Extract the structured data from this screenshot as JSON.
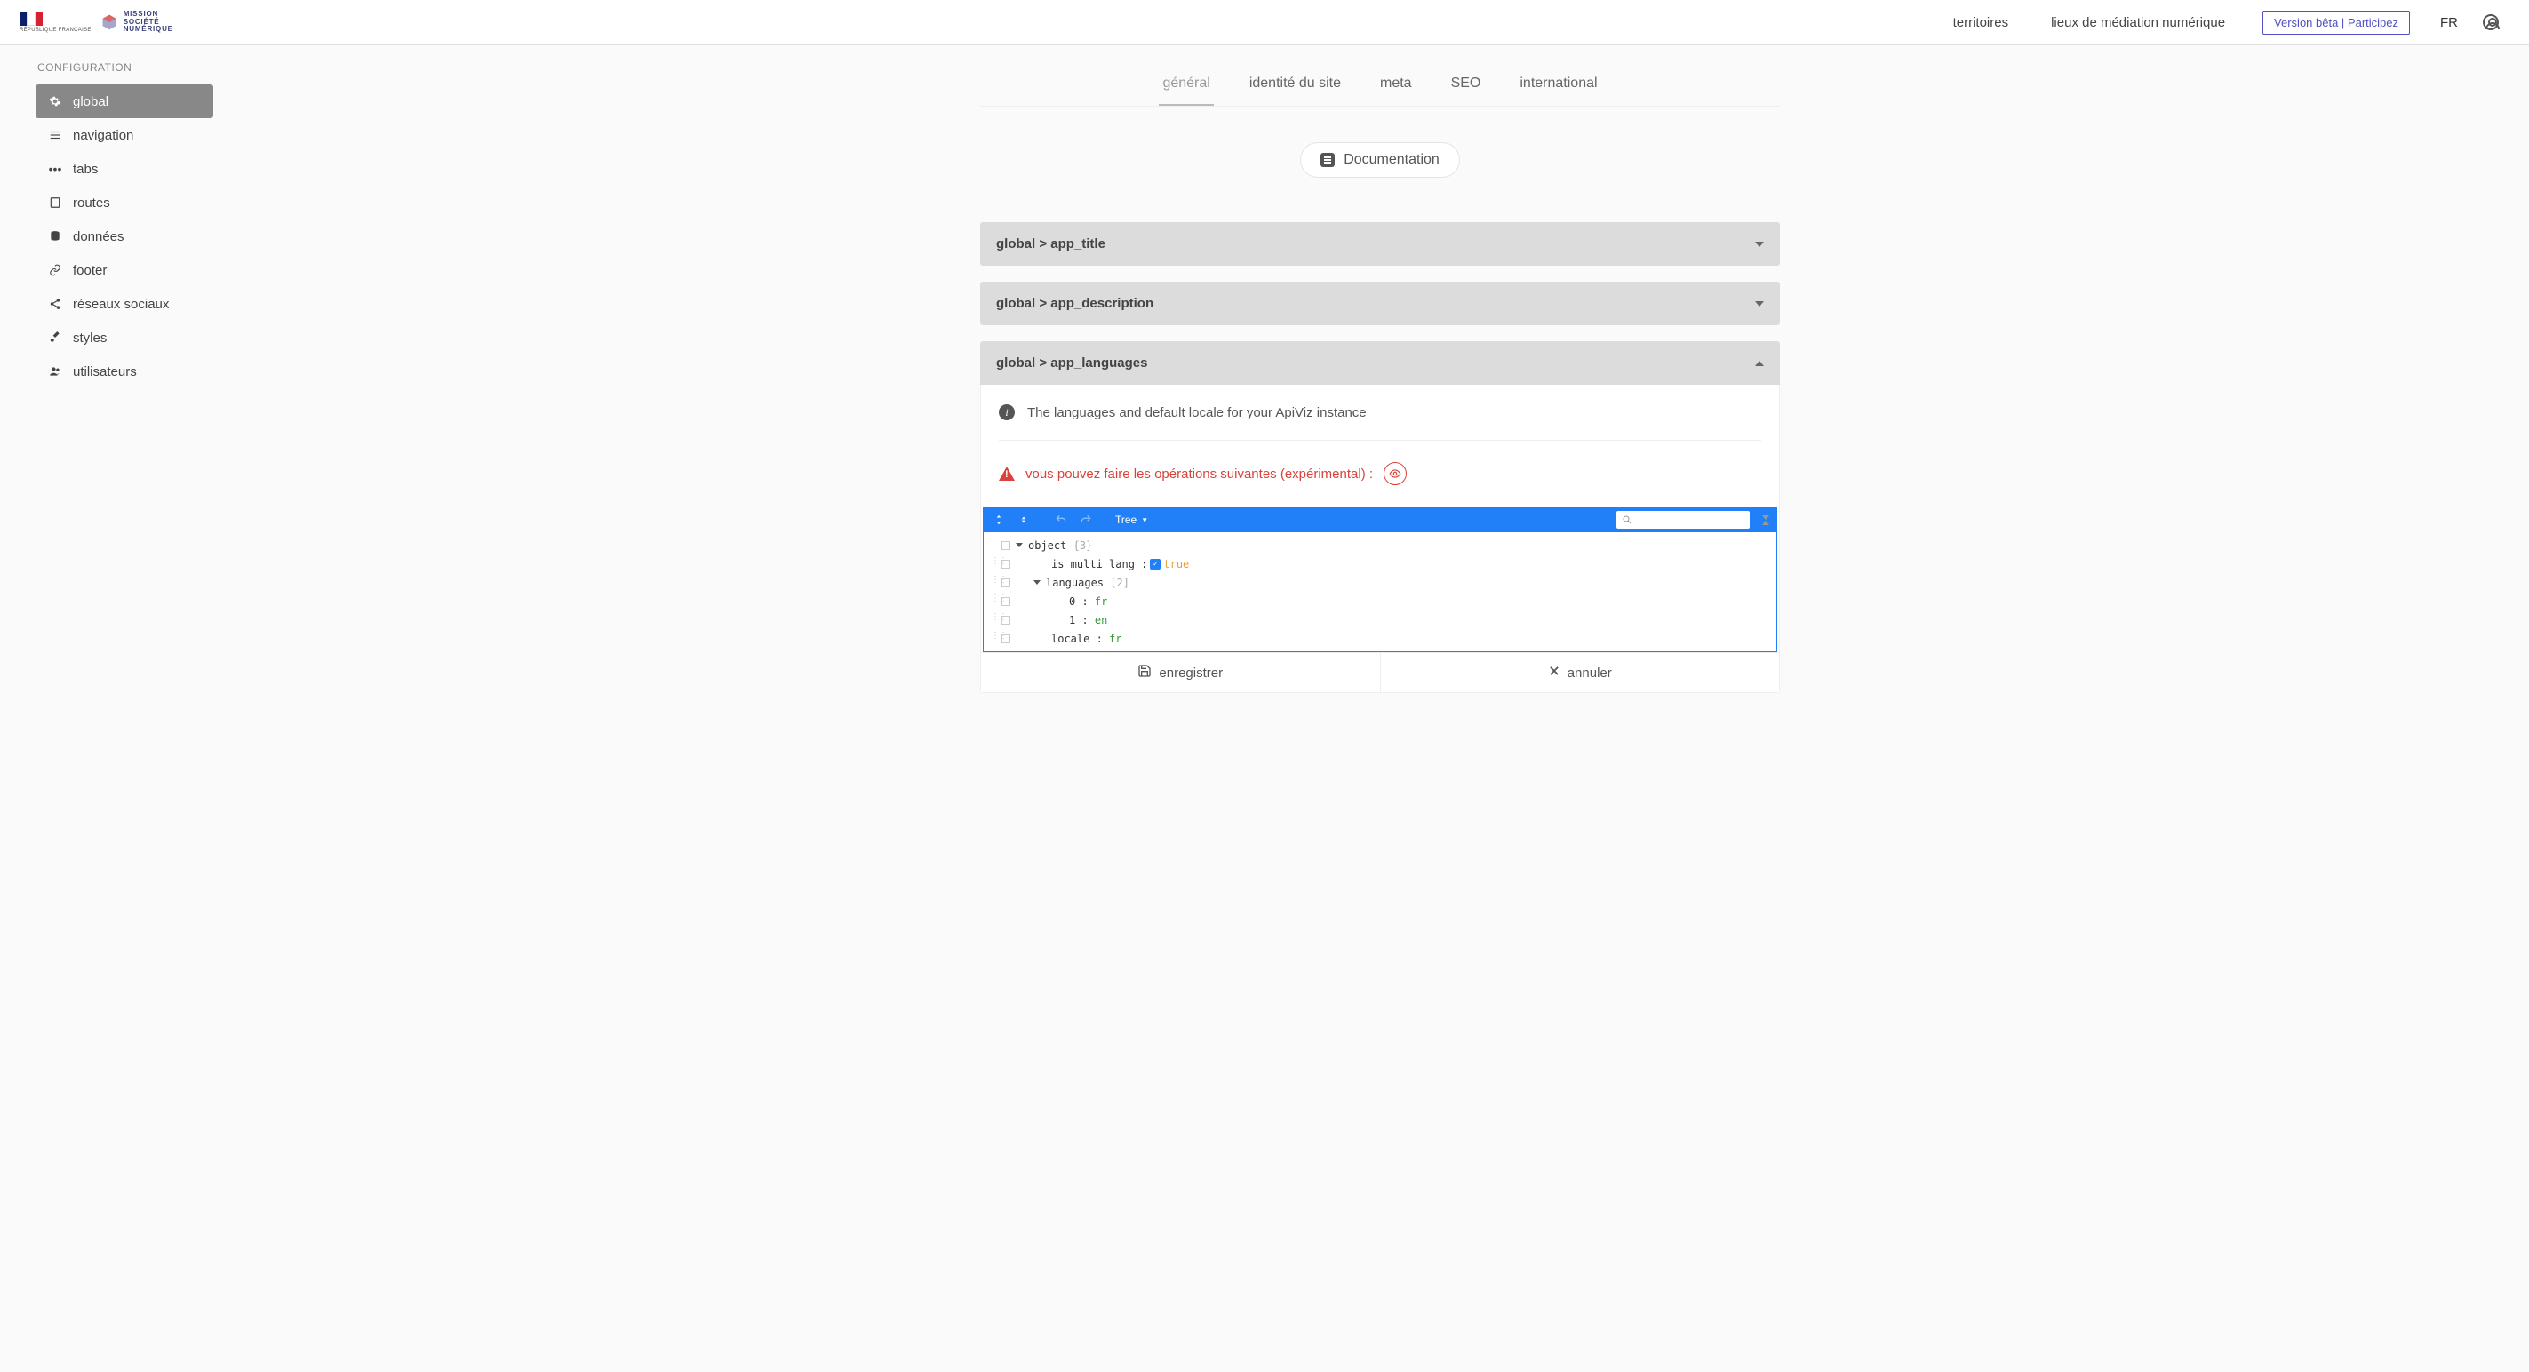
{
  "header": {
    "gov_text": "RÉPUBLIQUE FRANÇAISE",
    "mission_l1": "MISSION",
    "mission_l2": "SOCIÉTÉ",
    "mission_l3": "NUMÉRIQUE",
    "nav": {
      "territoires": "territoires",
      "lieux": "lieux de médiation numérique"
    },
    "beta_btn": "Version bêta | Participez",
    "lang": "FR"
  },
  "sidebar": {
    "title": "CONFIGURATION",
    "items": [
      {
        "id": "global",
        "label": "global",
        "icon": "gear-icon",
        "active": true
      },
      {
        "id": "navigation",
        "label": "navigation",
        "icon": "menu-icon"
      },
      {
        "id": "tabs",
        "label": "tabs",
        "icon": "dots-icon"
      },
      {
        "id": "routes",
        "label": "routes",
        "icon": "page-icon"
      },
      {
        "id": "donnees",
        "label": "données",
        "icon": "database-icon"
      },
      {
        "id": "footer",
        "label": "footer",
        "icon": "link-icon"
      },
      {
        "id": "reseaux",
        "label": "réseaux sociaux",
        "icon": "share-icon"
      },
      {
        "id": "styles",
        "label": "styles",
        "icon": "brush-icon"
      },
      {
        "id": "utilisateurs",
        "label": "utilisateurs",
        "icon": "users-icon"
      }
    ]
  },
  "tabs": [
    {
      "id": "general",
      "label": "général",
      "active": true
    },
    {
      "id": "identite",
      "label": "identité du site"
    },
    {
      "id": "meta",
      "label": "meta"
    },
    {
      "id": "seo",
      "label": "SEO"
    },
    {
      "id": "international",
      "label": "international"
    }
  ],
  "doc_button": "Documentation",
  "panels": {
    "app_title": {
      "header": "global  > app_title"
    },
    "app_description": {
      "header": "global  > app_description"
    },
    "app_languages": {
      "header": "global  > app_languages",
      "info_text": "The languages and default locale for your ApiViz instance",
      "warn_text": "vous pouvez faire les opérations suivantes (expérimental) :",
      "editor": {
        "mode_label": "Tree",
        "root_label": "object",
        "root_count": "{3}",
        "rows": {
          "is_multi_lang_key": "is_multi_lang",
          "is_multi_lang_val": "true",
          "languages_key": "languages",
          "languages_count": "[2]",
          "lang0_key": "0",
          "lang0_val": "fr",
          "lang1_key": "1",
          "lang1_val": "en",
          "locale_key": "locale",
          "locale_val": "fr"
        }
      },
      "actions": {
        "save": "enregistrer",
        "cancel": "annuler"
      }
    }
  }
}
